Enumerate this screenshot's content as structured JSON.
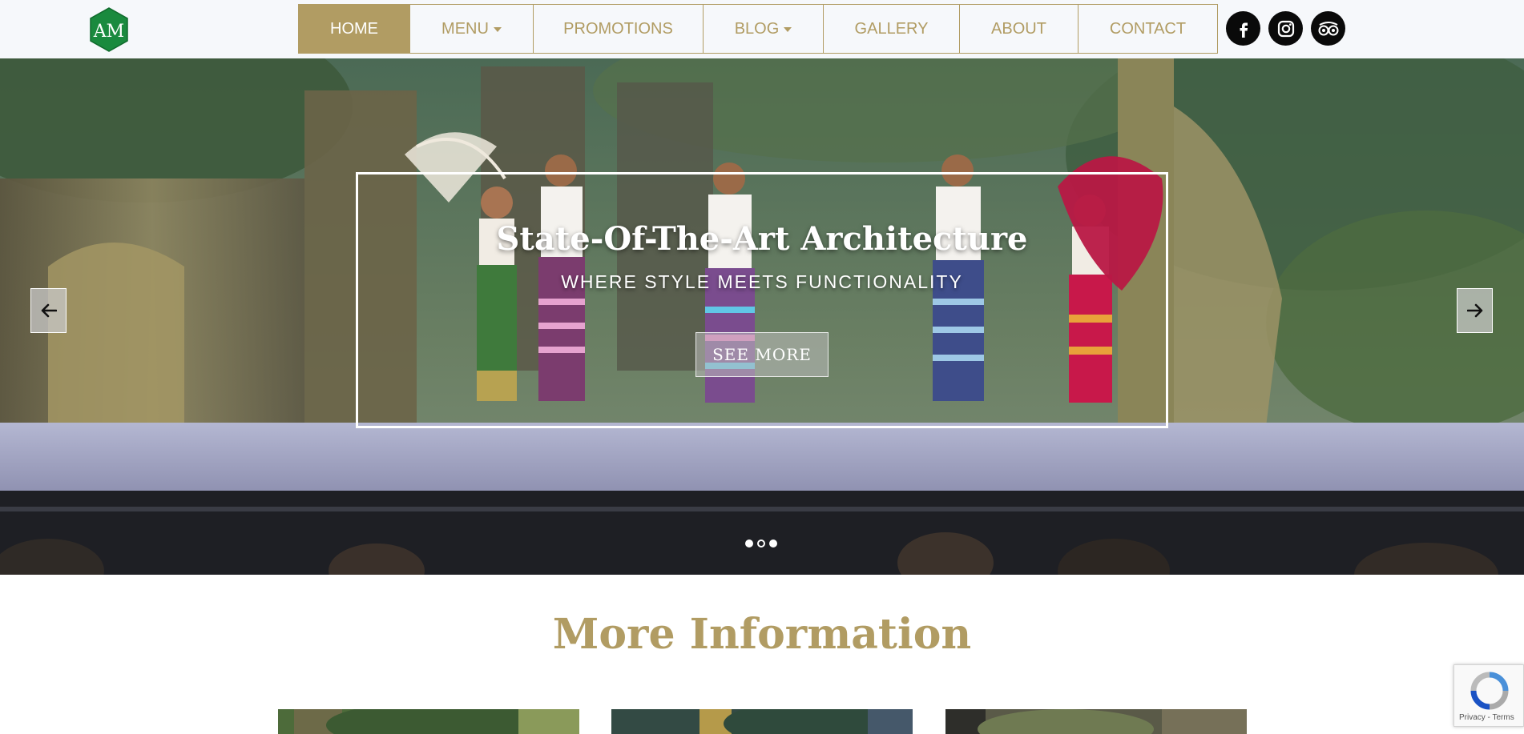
{
  "brand": {
    "logo_letters": "AM",
    "logo_color": "#1a8a3e",
    "accent_color": "#b19c63"
  },
  "nav": {
    "items": [
      {
        "label": "HOME",
        "active": true,
        "dropdown": false
      },
      {
        "label": "MENU",
        "active": false,
        "dropdown": true
      },
      {
        "label": "PROMOTIONS",
        "active": false,
        "dropdown": false
      },
      {
        "label": "BLOG",
        "active": false,
        "dropdown": true
      },
      {
        "label": "GALLERY",
        "active": false,
        "dropdown": false
      },
      {
        "label": "ABOUT",
        "active": false,
        "dropdown": false
      },
      {
        "label": "CONTACT",
        "active": false,
        "dropdown": false
      }
    ]
  },
  "socials": [
    {
      "icon": "facebook-icon"
    },
    {
      "icon": "instagram-icon"
    },
    {
      "icon": "tripadvisor-icon"
    }
  ],
  "hero": {
    "title": "State-Of-The-Art Architecture",
    "subtitle": "WHERE STYLE MEETS FUNCTIONALITY",
    "button_label": "SEE MORE",
    "prev_icon": "arrow-left-icon",
    "next_icon": "arrow-right-icon",
    "slide_count": 3,
    "active_slide": 2
  },
  "section": {
    "title": "More Information"
  },
  "recaptcha": {
    "links": "Privacy - Terms"
  }
}
